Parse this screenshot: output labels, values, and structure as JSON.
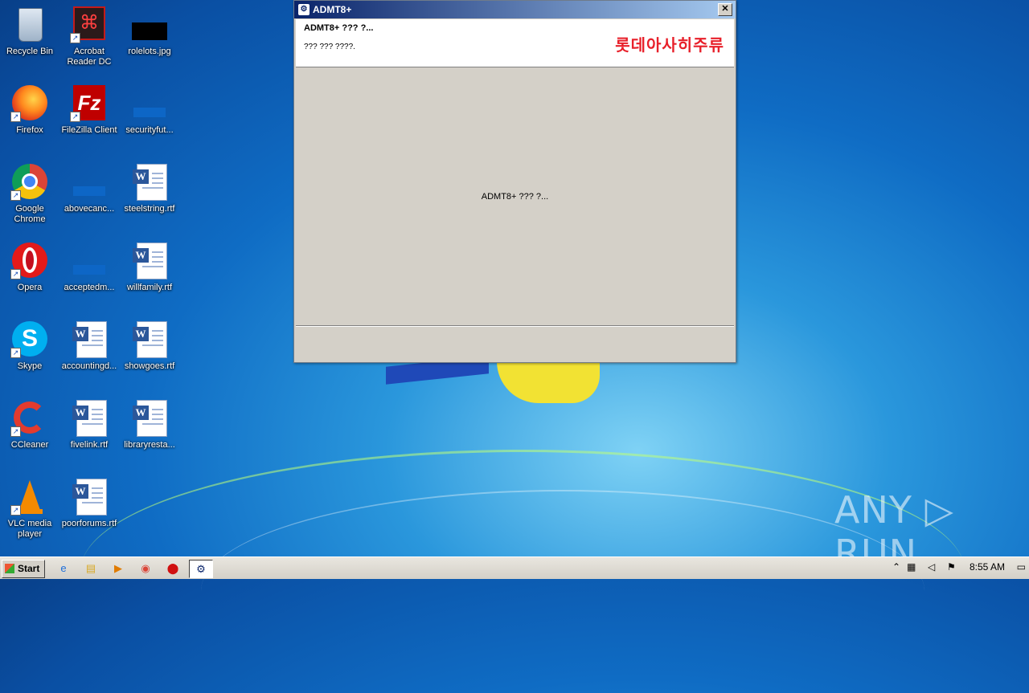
{
  "desktop": {
    "icons": [
      {
        "label": "Recycle Bin",
        "icon": "recycle-bin-icon"
      },
      {
        "label": "Acrobat Reader DC",
        "icon": "acrobat-icon"
      },
      {
        "label": "rolelots.jpg",
        "icon": "image-file-icon"
      },
      {
        "label": "Firefox",
        "icon": "firefox-icon"
      },
      {
        "label": "FileZilla Client",
        "icon": "filezilla-icon"
      },
      {
        "label": "securityfut...",
        "icon": "file-icon"
      },
      {
        "label": "Google Chrome",
        "icon": "chrome-icon"
      },
      {
        "label": "abovecanc...",
        "icon": "file-icon"
      },
      {
        "label": "steelstring.rtf",
        "icon": "word-doc-icon"
      },
      {
        "label": "Opera",
        "icon": "opera-icon"
      },
      {
        "label": "acceptedm...",
        "icon": "file-icon"
      },
      {
        "label": "willfamily.rtf",
        "icon": "word-doc-icon"
      },
      {
        "label": "Skype",
        "icon": "skype-icon"
      },
      {
        "label": "accountingd...",
        "icon": "word-doc-icon"
      },
      {
        "label": "showgoes.rtf",
        "icon": "word-doc-icon"
      },
      {
        "label": "CCleaner",
        "icon": "ccleaner-icon"
      },
      {
        "label": "fivelink.rtf",
        "icon": "word-doc-icon"
      },
      {
        "label": "libraryresta...",
        "icon": "word-doc-icon"
      },
      {
        "label": "VLC media player",
        "icon": "vlc-icon"
      },
      {
        "label": "poorforums.rtf",
        "icon": "word-doc-icon"
      }
    ]
  },
  "window": {
    "title": "ADMT8+",
    "header_title": "ADMT8+ ??? ?...",
    "header_subtitle": "??? ??? ????.",
    "brand": "롯데아사히주류",
    "body_text": "ADMT8+ ??? ?..."
  },
  "taskbar": {
    "start_label": "Start",
    "clock": "8:55 AM"
  },
  "watermark": "ANY ▷ RUN"
}
